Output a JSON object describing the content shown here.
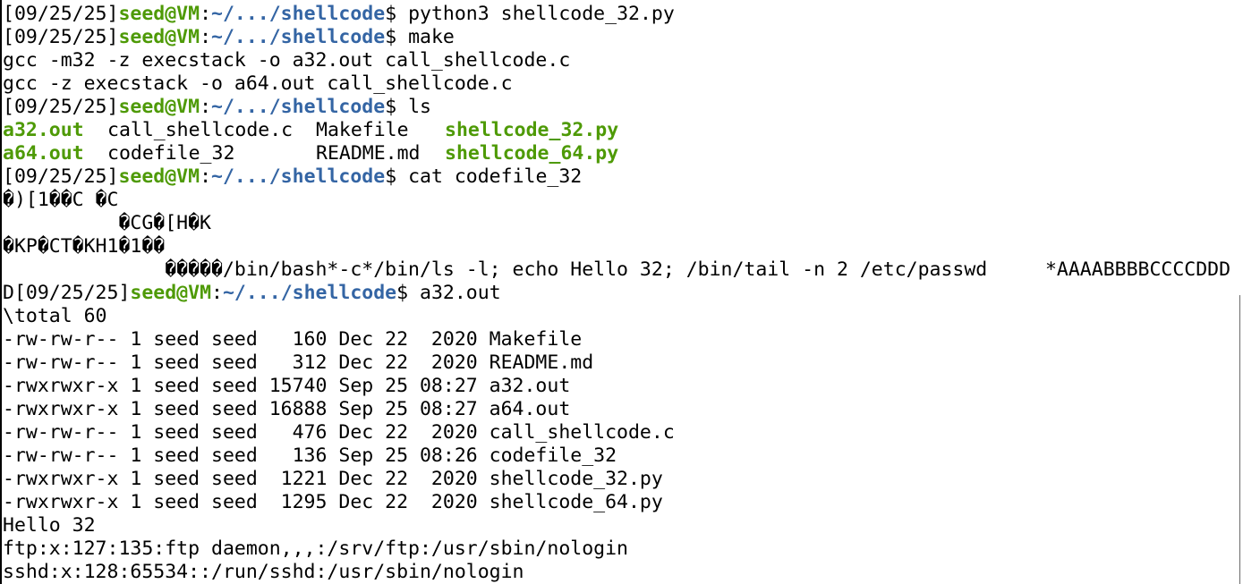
{
  "prompt": {
    "date": "[09/25/25]",
    "user": "seed@VM",
    "colon": ":",
    "path": "~/.../shellcode",
    "dollar": "$ "
  },
  "commands": {
    "c1": "python3 shellcode_32.py",
    "c2": "make",
    "c3": "ls",
    "c4": "cat codefile_32",
    "c5": "a32.out"
  },
  "make_output": [
    "gcc -m32 -z execstack -o a32.out call_shellcode.c",
    "gcc -z execstack -o a64.out call_shellcode.c"
  ],
  "ls_output": {
    "row1": [
      "a32.out",
      "call_shellcode.c",
      "Makefile",
      "shellcode_32.py"
    ],
    "row2": [
      "a64.out",
      "codefile_32",
      "README.md",
      "shellcode_64.py"
    ]
  },
  "cat_output": [
    "�)[1��C �C",
    "          �CG�[H�K",
    "�KP�CT�KH1�1��",
    "              �����/bin/bash*-c*/bin/ls -l; echo Hello 32; /bin/tail -n 2 /etc/passwd     *AAAABBBBCCCCDDD"
  ],
  "wrap_prefix": "D",
  "run_output": [
    "\\total 60",
    "-rw-rw-r-- 1 seed seed   160 Dec 22  2020 Makefile",
    "-rw-rw-r-- 1 seed seed   312 Dec 22  2020 README.md",
    "-rwxrwxr-x 1 seed seed 15740 Sep 25 08:27 a32.out",
    "-rwxrwxr-x 1 seed seed 16888 Sep 25 08:27 a64.out",
    "-rw-rw-r-- 1 seed seed   476 Dec 22  2020 call_shellcode.c",
    "-rw-rw-r-- 1 seed seed   136 Sep 25 08:26 codefile_32",
    "-rwxrwxr-x 1 seed seed  1221 Dec 22  2020 shellcode_32.py",
    "-rwxrwxr-x 1 seed seed  1295 Dec 22  2020 shellcode_64.py",
    "Hello 32",
    "ftp:x:127:135:ftp daemon,,,:/srv/ftp:/usr/sbin/nologin",
    "sshd:x:128:65534::/run/sshd:/usr/sbin/nologin"
  ],
  "colors": {
    "background": "#ffffff",
    "text": "#000000",
    "user": "#4e9a06",
    "path": "#3465a4",
    "executable": "#4e9a06"
  }
}
